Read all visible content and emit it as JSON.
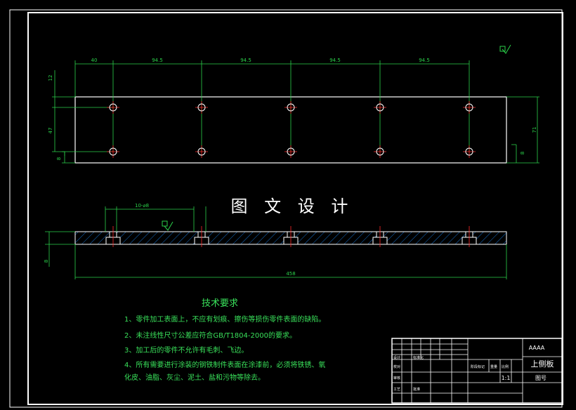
{
  "overlay_title": "图 文 设 计",
  "top_dims": [
    "40",
    "94.5",
    "94.5",
    "94.5",
    "94.5"
  ],
  "left_dims": [
    "12",
    "47",
    "8"
  ],
  "right_dim": "71",
  "right_small": "8",
  "section": {
    "hole_callout": "10-⌀8",
    "small_left_dim": "8",
    "total_length": "458"
  },
  "notes": {
    "heading": "技术要求",
    "items": [
      "1、零件加工表面上，不应有划痕、擦伤等损伤零件表面的缺陷。",
      "2、未注线性尺寸公差应符合GB/T1804-2000的要求。",
      "3、加工后的零件不允许有毛刺、飞边。",
      "4、所有需要进行涂装的钢铁制件表面在涂漆前，必须将铁锈、氧",
      "化皮、油脂、灰尘、泥土、盐和污物等除去。"
    ]
  },
  "title_block": {
    "code": "AAAA",
    "part_name": "上侧板",
    "drawing_no_label": "图号",
    "scale": "1:1",
    "cells": [
      "设计",
      "标准化",
      "校对",
      "审核",
      "工艺",
      "批准",
      "阶段标记",
      "重量",
      "比例"
    ]
  },
  "colors": {
    "background": "#000000",
    "outline": "#ffffff",
    "dimension": "#2bd14a",
    "centerline": "#ff2a2a",
    "hatch": "#1a8cff"
  }
}
